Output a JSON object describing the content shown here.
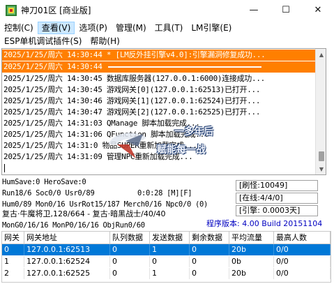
{
  "window": {
    "title": "神刀01区 [商业版]",
    "minimize": "—",
    "maximize": "☐",
    "close": "✕"
  },
  "menu": {
    "row1": [
      "控制(C)",
      "查看(V)",
      "选项(P)",
      "管理(M)",
      "工具(T)",
      "LM引擎(E)"
    ],
    "row2": [
      "ESP单机调试插件(S)",
      "帮助(H)"
    ]
  },
  "log": {
    "lines": [
      "2025/1/25/周六 14:30:44 * [LM反外挂引擎v4.0]:引擎漏洞修复成功...",
      "2025/1/25/周六 14:30:44 ",
      "2025/1/25/周六 14:30:45 数据库服务器(127.0.0.1:6000)连接成功...",
      "2025/1/25/周六 14:30:45 游戏网关[0](127.0.0.1:62513)已打开...",
      "2025/1/25/周六 14:30:46 游戏网关[1](127.0.0.1:62524)已打开...",
      "2025/1/25/周六 14:30:47 游戏网关[2](127.0.0.1:62525)已打开...",
      "2025/1/25/周六 14:31:03 QManage 脚本加载完成...",
      "2025/1/25/周六 14:31:06 QFunction 脚本加载完成...",
      "2025/1/25/周六 14:31:0 物品SUPER重新加载完成...",
      "2025/1/25/周六 14:31:09 管理NPC重新加载完成..."
    ]
  },
  "watermark": {
    "line1": "一多年后",
    "line2": "赋能每一战"
  },
  "status": {
    "humsave": "HumSave:0 HeroSave:0",
    "run": "Run18/6 Soc0/0 Usr0/89",
    "time": "0:0:28 [M][F]",
    "hum": "Hum0/89 Mon0/16 UsrRot15/187 Merch0/16 Npc0/0 (0)",
    "map": "复古·牛魔将卫,128/664 - 复古·暗黑战士/40/40",
    "mon": "MonG0/16/16 MonP0/16/16 ObjRun0/60",
    "refresh": "[刷怪:10049]",
    "online": "[在线:4/4/0]",
    "engine": "[引擎: 0.0003天]",
    "version": "程序版本: 4.00 Build 20151104"
  },
  "table": {
    "headers": [
      "网关",
      "网关地址",
      "队列数据",
      "发送数据",
      "剩余数据",
      "平均流量",
      "最高人数"
    ],
    "rows": [
      [
        "0",
        "127.0.0.1:62513",
        "0",
        "1",
        "0",
        "20b",
        "0/0"
      ],
      [
        "1",
        "127.0.0.1:62524",
        "0",
        "0",
        "0",
        "0b",
        "0/0"
      ],
      [
        "2",
        "127.0.0.1:62525",
        "0",
        "1",
        "0",
        "20b",
        "0/0"
      ]
    ]
  },
  "colors": {
    "highlight": "#ff7f00",
    "selection": "#0078d7",
    "version_text": "#0000c0"
  }
}
